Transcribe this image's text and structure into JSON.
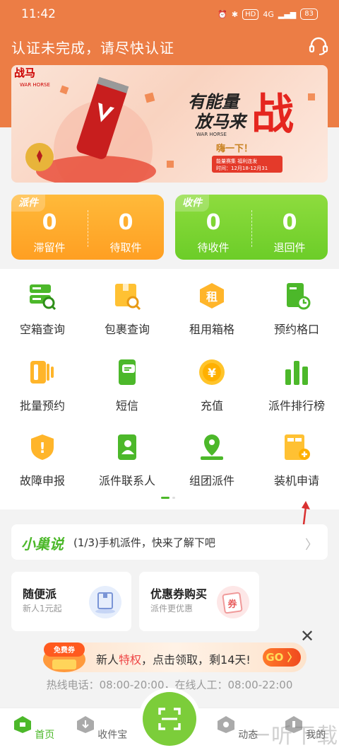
{
  "status_bar": {
    "time": "11:42",
    "hd": "HD",
    "signal": "4G",
    "battery": "83"
  },
  "header": {
    "title": "认证未完成，请尽快认证",
    "service_icon": "headset-icon"
  },
  "banner": {
    "brand_cn": "战马",
    "brand_en": "WAR HORSE",
    "slogan_line1": "有能量",
    "slogan_line2": "放马来",
    "slogan_big": "战",
    "brand_en_small": "WAR HORSE",
    "promo_title": "嗨一下！",
    "promo_line1": "能量赛集 福利连发",
    "promo_line2": "时间：12月18-12月31"
  },
  "dispatch_card": {
    "tag": "派件",
    "stats": [
      {
        "value": "0",
        "label": "滞留件"
      },
      {
        "value": "0",
        "label": "待取件"
      }
    ]
  },
  "receive_card": {
    "tag": "收件",
    "stats": [
      {
        "value": "0",
        "label": "待收件"
      },
      {
        "value": "0",
        "label": "退回件"
      }
    ]
  },
  "grid": [
    {
      "label": "空箱查询",
      "icon": "empty-box-search-icon"
    },
    {
      "label": "包裹查询",
      "icon": "parcel-search-icon"
    },
    {
      "label": "租用箱格",
      "icon": "rent-locker-icon",
      "glyph": "租"
    },
    {
      "label": "预约格口",
      "icon": "reserve-slot-icon"
    },
    {
      "label": "批量预约",
      "icon": "batch-reserve-icon"
    },
    {
      "label": "短信",
      "icon": "sms-icon"
    },
    {
      "label": "充值",
      "icon": "recharge-coin-icon",
      "glyph": "¥"
    },
    {
      "label": "派件排行榜",
      "icon": "ranking-bars-icon"
    },
    {
      "label": "故障申报",
      "icon": "fault-report-icon",
      "glyph": "!"
    },
    {
      "label": "派件联系人",
      "icon": "contacts-icon"
    },
    {
      "label": "组团派件",
      "icon": "group-dispatch-icon"
    },
    {
      "label": "装机申请",
      "icon": "install-apply-icon"
    }
  ],
  "news": {
    "brand": "小巢说",
    "text": "(1/3)手机派件，快来了解下吧"
  },
  "promos": [
    {
      "title": "随便派",
      "subtitle": "新人1元起"
    },
    {
      "title": "优惠券购买",
      "subtitle": "派件更优惠",
      "badge": "券"
    }
  ],
  "new_user": {
    "badge": "免费券",
    "text_prefix": "新人",
    "text_highlight": "特权",
    "text_suffix": "，点击领取，剩14天!",
    "go": "GO"
  },
  "hotline": "热线电话：08:00-20:00，在线人工：08:00-22:00",
  "bottom_nav": [
    {
      "label": "首页",
      "icon": "home-icon",
      "active": true
    },
    {
      "label": "收件宝",
      "icon": "download-icon"
    },
    {
      "label": "动态",
      "icon": "activity-icon"
    },
    {
      "label": "我的",
      "icon": "profile-icon"
    }
  ],
  "watermark": "一听下载",
  "colors": {
    "header_orange": "#ec7d45",
    "accent_green": "#4cb82a",
    "dispatch_orange": "#ffa72a",
    "receive_green": "#7ad432"
  }
}
